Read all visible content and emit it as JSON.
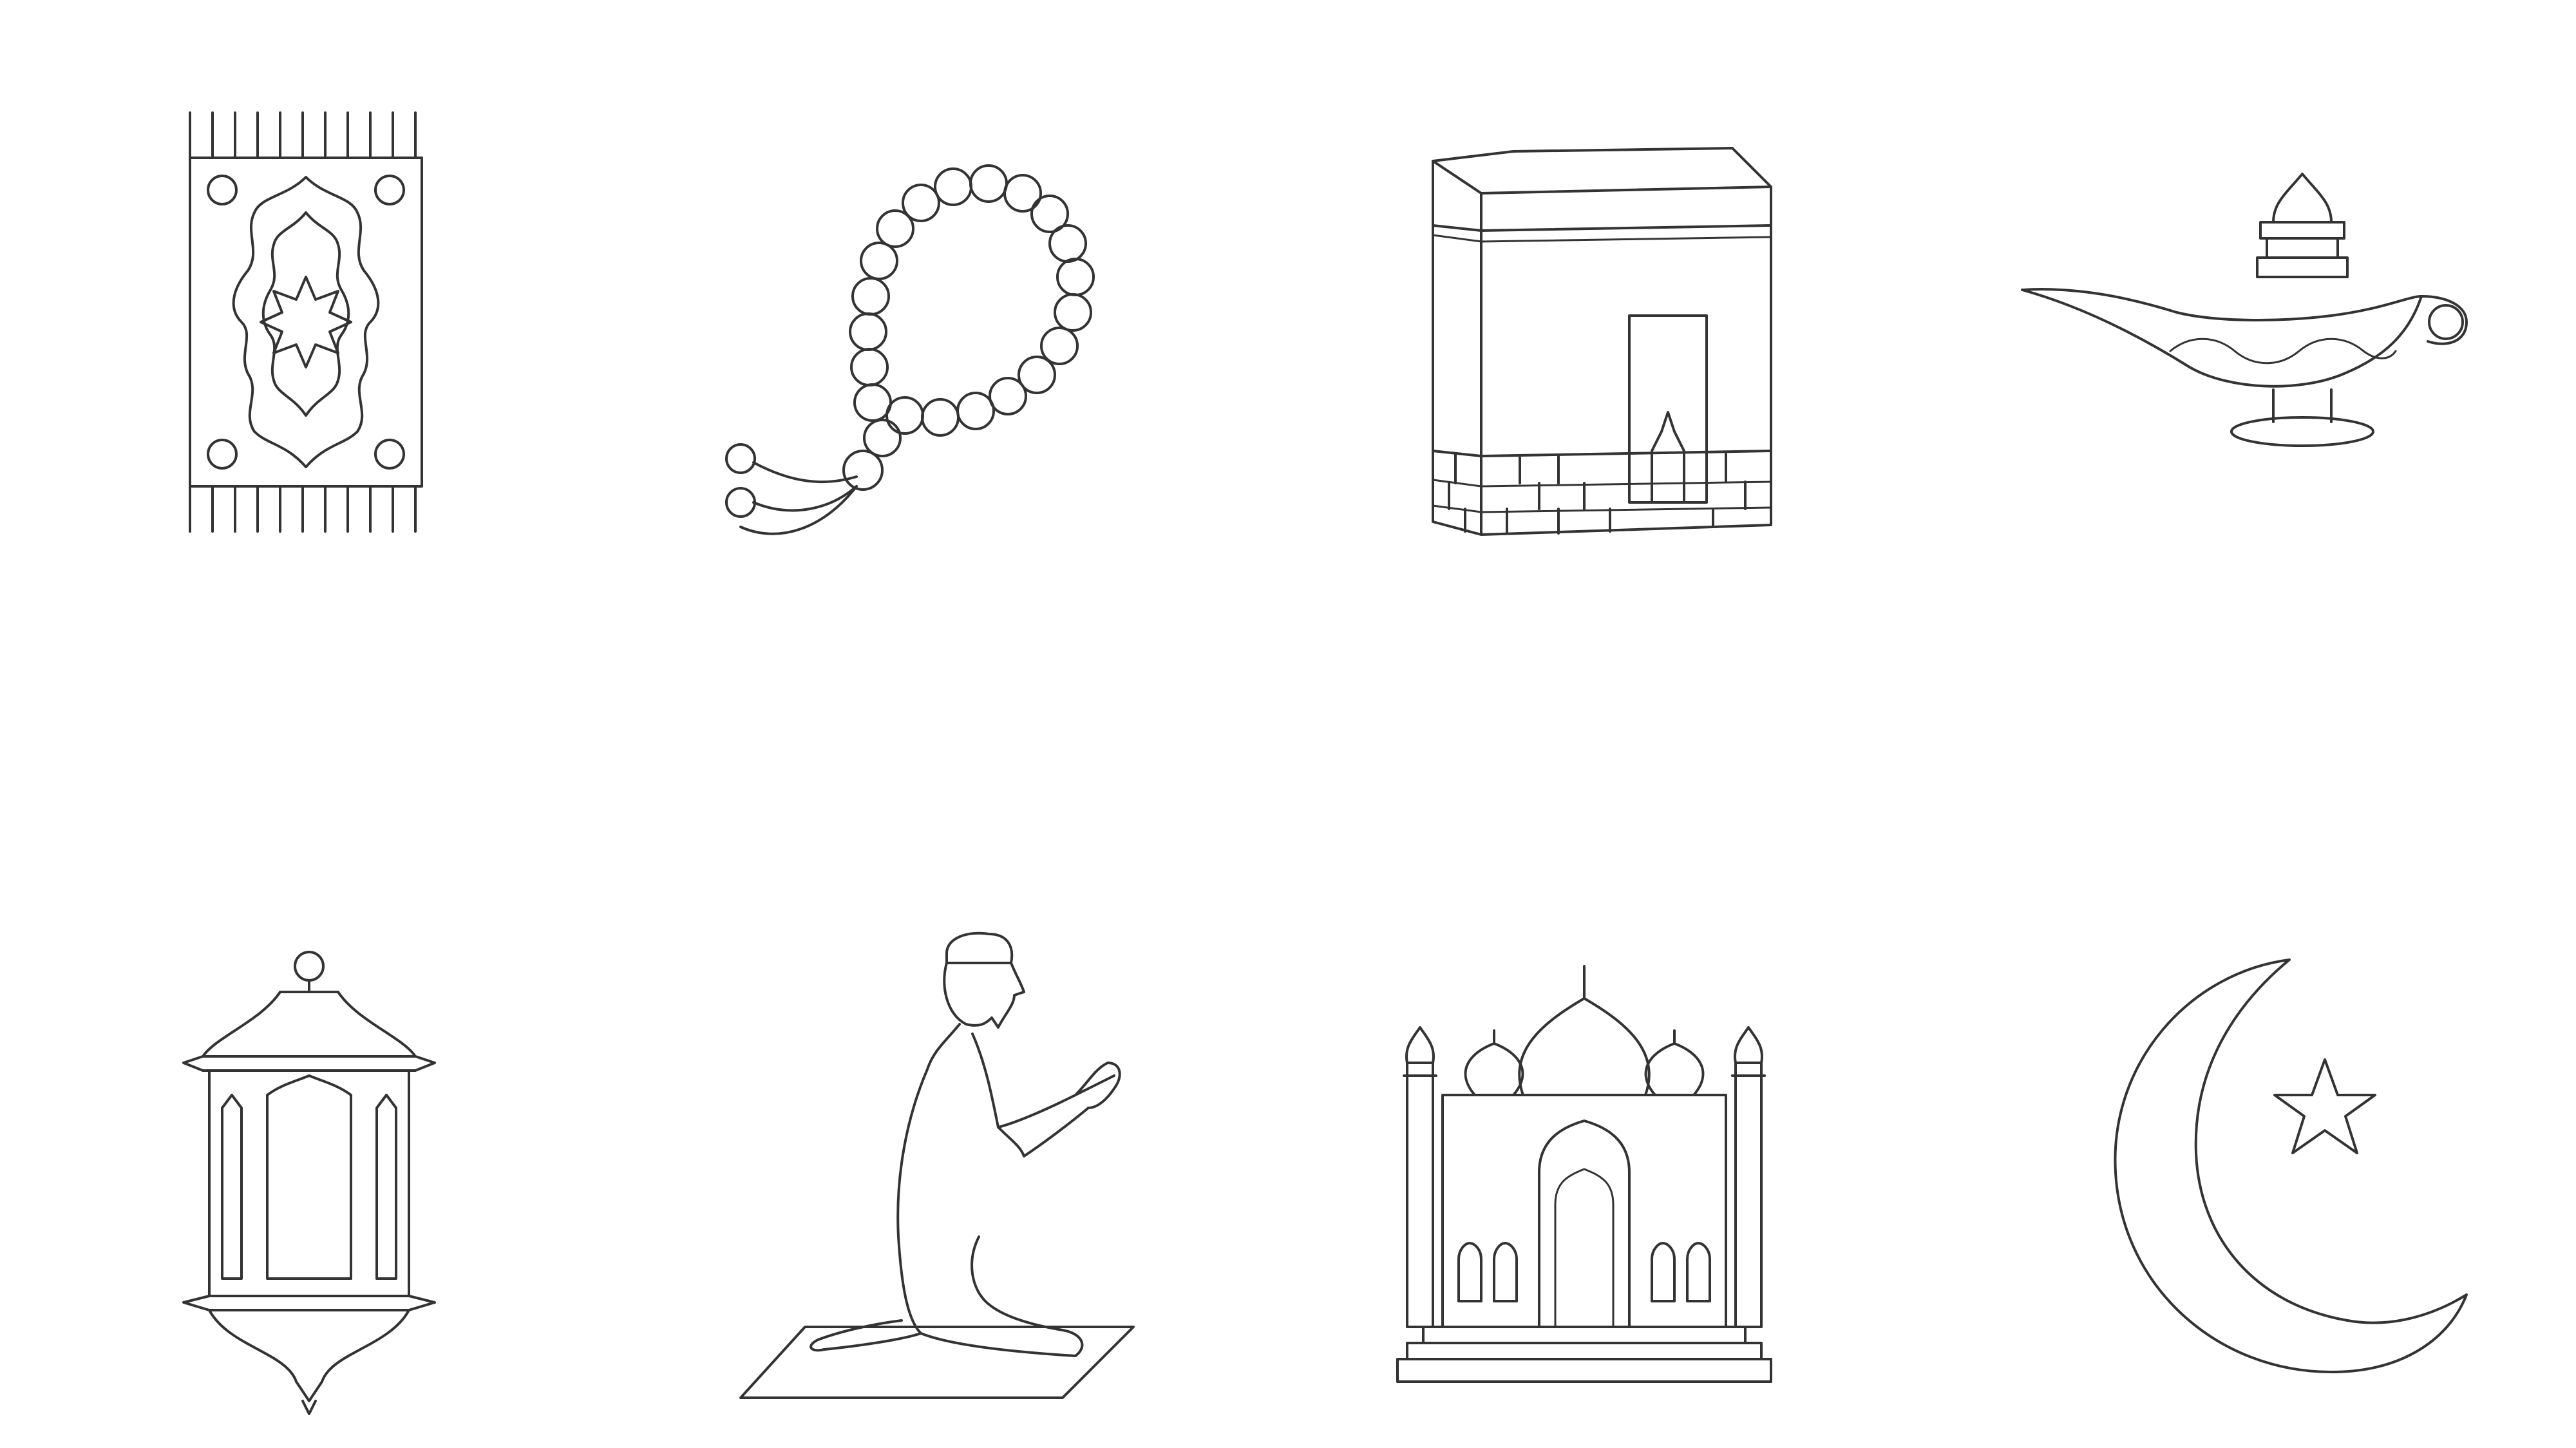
{
  "icons": [
    {
      "name": "prayer-rug-icon"
    },
    {
      "name": "prayer-beads-icon"
    },
    {
      "name": "kaaba-icon"
    },
    {
      "name": "oil-lamp-icon"
    },
    {
      "name": "ramadan-lantern-icon"
    },
    {
      "name": "praying-man-icon"
    },
    {
      "name": "mosque-icon"
    },
    {
      "name": "crescent-star-icon"
    }
  ],
  "colors": {
    "background": "#ffffff",
    "line": "#333333"
  }
}
